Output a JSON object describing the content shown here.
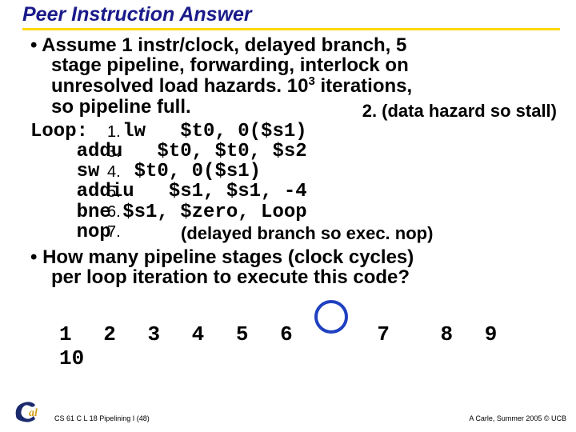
{
  "title": "Peer Instruction Answer",
  "para1_line1": "• Assume 1 instr/clock, delayed branch, 5",
  "para1_line2": "stage pipeline, forwarding, interlock on",
  "para1_line3_a": "unresolved load hazards. 10",
  "para1_line3_sup": "3",
  "para1_line3_b": " iterations,",
  "para1_line4": "so pipeline full.",
  "anno_hazard": "2. (data hazard so stall)",
  "code": {
    "l1": "Loop:   lw   $t0, 0($s1)",
    "l2": "    addu   $t0, $t0, $s2",
    "l3": "    sw   $t0, 0($s1)",
    "l4": "    addiu   $s1, $s1, -4",
    "l5": "    bne $s1, $zero, Loop",
    "l6": "    nop"
  },
  "stage": {
    "n1": "1.",
    "n3": "3.",
    "n4": "4.",
    "n5": "5.",
    "n6": "6.",
    "n7": "7."
  },
  "anno_nop": "(delayed branch so exec. nop)",
  "para2_line1": "• How many pipeline stages (clock cycles)",
  "para2_line2": "per loop iteration to execute this code?",
  "answers": {
    "a1": "1",
    "a2": "2",
    "a3": "3",
    "a4": "4",
    "a5": "5",
    "a6": "6",
    "a7": "7",
    "a8": "8",
    "a9": "9",
    "a10": "10"
  },
  "footer_left": "CS 61 C L 18 Pipelining I (48)",
  "footer_right": "A Carle, Summer 2005 © UCB"
}
